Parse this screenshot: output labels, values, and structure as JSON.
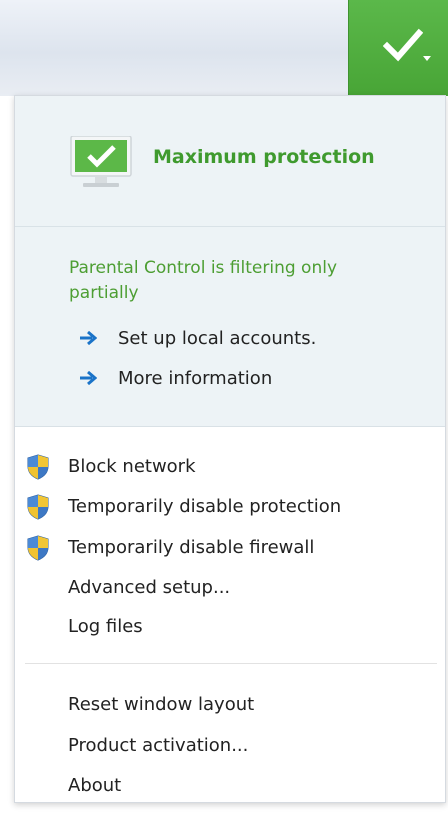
{
  "status_button": {
    "icon": "check-icon",
    "dropdown_icon": "dropdown-arrow-icon",
    "color": "#4caf3f"
  },
  "summary": {
    "status_title": "Maximum protection",
    "notice": "Parental Control is filtering only partially",
    "links": [
      {
        "label": "Set up local accounts.",
        "icon": "arrow-right-icon"
      },
      {
        "label": "More information",
        "icon": "arrow-right-icon"
      }
    ]
  },
  "menu": {
    "items": [
      {
        "label": "Block network",
        "icon": "shield-icon"
      },
      {
        "label": "Temporarily disable protection",
        "icon": "shield-icon"
      },
      {
        "label": "Temporarily disable firewall",
        "icon": "shield-icon"
      },
      {
        "label": "Advanced setup..."
      },
      {
        "label": "Log files"
      }
    ],
    "items2": [
      {
        "label": "Reset window layout"
      },
      {
        "label": "Product activation..."
      },
      {
        "label": "About"
      }
    ]
  },
  "colors": {
    "accent_green": "#4caf3f",
    "link_arrow": "#1a73c8"
  }
}
